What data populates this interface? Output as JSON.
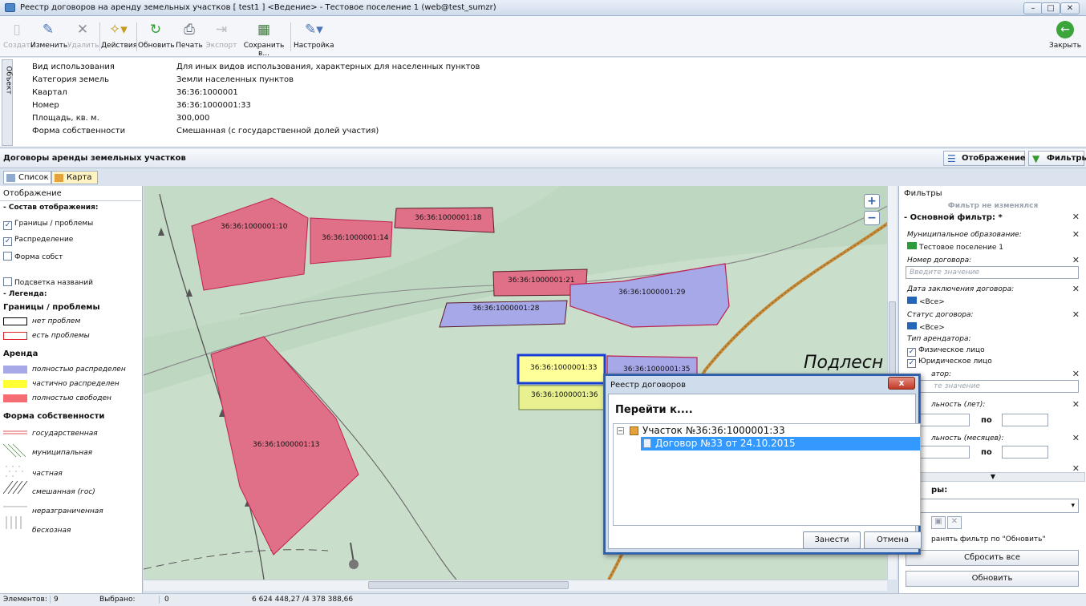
{
  "window": {
    "title": "Реестр договоров на аренду земельных участков [ test1 ] <Ведение> - Тестовое поселение 1 (web@test_sumzr)"
  },
  "toolbar": {
    "create": "Создать",
    "edit": "Изменить",
    "delete": "Удалить",
    "actions": "Действия",
    "refresh": "Обновить",
    "print": "Печать",
    "export": "Экспорт",
    "save_as": "Сохранить в...",
    "settings": "Настройка",
    "close": "Закрыть"
  },
  "object_panel": {
    "tab_label": "Объект",
    "rows": [
      {
        "label": "Вид использования",
        "value": "Для иных видов использования, характерных для населенных пунктов"
      },
      {
        "label": "Категория земель",
        "value": "Земли населенных пунктов"
      },
      {
        "label": "Квартал",
        "value": "36:36:1000001"
      },
      {
        "label": "Номер",
        "value": "36:36:1000001:33"
      },
      {
        "label": "Площадь, кв. м.",
        "value": "300,000"
      },
      {
        "label": "Форма собственности",
        "value": "Смешанная (с государственной долей участия)"
      }
    ]
  },
  "section": {
    "title": "Договоры аренды земельных участков",
    "display_button": "Отображение",
    "filters_button": "Фильтры"
  },
  "view_tabs": {
    "list": "Список",
    "map": "Карта"
  },
  "left_panel": {
    "title": "Отображение",
    "composition_header": "- Состав отображения:",
    "checkboxes": [
      {
        "label": "Границы / проблемы",
        "checked": true
      },
      {
        "label": "Распределение",
        "checked": true
      },
      {
        "label": "Форма собст",
        "checked": false
      }
    ],
    "highlight_names": {
      "label": "Подсветка названий",
      "checked": false
    },
    "legend_header": "- Легенда:",
    "borders_header": "Границы / проблемы",
    "borders": [
      {
        "label": "нет проблем",
        "color": "#000000"
      },
      {
        "label": "есть проблемы",
        "color": "#e0262c"
      }
    ],
    "lease_header": "Аренда",
    "lease": [
      {
        "label": "полностью распределен",
        "color": "#a7a8e8"
      },
      {
        "label": "частично распределен",
        "color": "#ffff33"
      },
      {
        "label": "полностью свободен",
        "color": "#f56c73"
      }
    ],
    "ownership_header": "Форма собственности",
    "ownership": [
      {
        "label": "государственная"
      },
      {
        "label": "муниципальная"
      },
      {
        "label": "частная"
      },
      {
        "label": "смешанная (гос)"
      },
      {
        "label": "неразграниченная"
      },
      {
        "label": "бесхозная"
      }
    ]
  },
  "map": {
    "parcels": [
      {
        "label": "36:36:1000001:10"
      },
      {
        "label": "36:36:1000001:14"
      },
      {
        "label": "36:36:1000001:18"
      },
      {
        "label": "36:36:1000001:21"
      },
      {
        "label": "36:36:1000001:29"
      },
      {
        "label": "36:36:1000001:28"
      },
      {
        "label": "36:36:1000001:33"
      },
      {
        "label": "36:36:1000001:35"
      },
      {
        "label": "36:36:1000001:36"
      },
      {
        "label": "36:36:1000001:13"
      }
    ],
    "place_label": "Подлесн",
    "zoom_in": "+",
    "zoom_out": "−"
  },
  "filters": {
    "title": "Фильтры",
    "unchanged": "Фильтр не изменялся",
    "main_filter": "- Основной фильтр: *",
    "municipality_label": "Муниципальное образование:",
    "municipality_value": "Тестовое поселение 1",
    "contract_number_label": "Номер договора:",
    "contract_number_placeholder": "Введите значение",
    "conclusion_date_label": "Дата заключения договора:",
    "conclusion_date_value": "<Все>",
    "status_label": "Статус договора:",
    "status_value": "<Все>",
    "tenant_type_label": "Тип арендатора:",
    "tenant_types": [
      {
        "label": "Физическое лицо",
        "checked": true
      },
      {
        "label": "Юридическое лицо",
        "checked": true
      }
    ],
    "tenant_label": "атор:",
    "tenant_placeholder": "те значение",
    "duration_years_label": "льность (лет):",
    "duration_months_label": "льность (месяцев):",
    "to_label": "по",
    "saved_filters_label": "ры:",
    "keep_filter": "ранять фильтр по \"Обновить\"",
    "reset_all": "Сбросить все",
    "refresh": "Обновить"
  },
  "dialog": {
    "title": "Реестр договоров",
    "close": "x",
    "heading": "Перейти к....",
    "tree_root": "Участок №36:36:1000001:33",
    "tree_child": "Договор №33 от 24.10.2015",
    "enter_button": "Занести",
    "cancel_button": "Отмена"
  },
  "status": {
    "elements_label": "Элементов:",
    "elements_value": "9",
    "selected_label": "Выбрано:",
    "selected_value": "0",
    "coords": "6 624 448,27 /4 378 388,66"
  }
}
